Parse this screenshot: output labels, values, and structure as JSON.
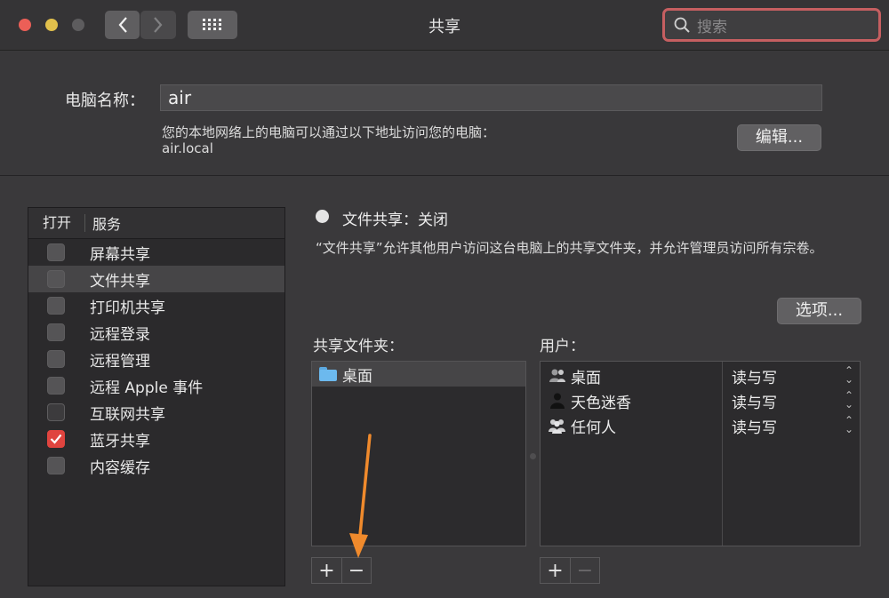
{
  "window": {
    "title": "共享"
  },
  "search": {
    "placeholder": "搜索"
  },
  "computer_name": {
    "label": "电脑名称：",
    "value": "air",
    "access_text": "您的本地网络上的电脑可以通过以下地址访问您的电脑：",
    "address": "air.local",
    "edit_button": "编辑..."
  },
  "services": {
    "header_on": "打开",
    "header_service": "服务",
    "items": [
      {
        "label": "屏幕共享",
        "checked": false,
        "selected": false,
        "dim": false
      },
      {
        "label": "文件共享",
        "checked": false,
        "selected": true,
        "dim": false
      },
      {
        "label": "打印机共享",
        "checked": false,
        "selected": false,
        "dim": false
      },
      {
        "label": "远程登录",
        "checked": false,
        "selected": false,
        "dim": false
      },
      {
        "label": "远程管理",
        "checked": false,
        "selected": false,
        "dim": false
      },
      {
        "label": "远程 Apple 事件",
        "checked": false,
        "selected": false,
        "dim": false
      },
      {
        "label": "互联网共享",
        "checked": false,
        "selected": false,
        "dim": true
      },
      {
        "label": "蓝牙共享",
        "checked": true,
        "selected": false,
        "dim": false
      },
      {
        "label": "内容缓存",
        "checked": false,
        "selected": false,
        "dim": false
      }
    ]
  },
  "file_sharing": {
    "status": "文件共享：关闭",
    "description": "“文件共享”允许其他用户访问这台电脑上的共享文件夹，并允许管理员访问所有宗卷。",
    "options_button": "选项...",
    "folders_label": "共享文件夹：",
    "users_label": "用户：",
    "folders": [
      "桌面"
    ],
    "users": [
      {
        "name": "桌面",
        "permission": "读与写",
        "icon": "group-icon"
      },
      {
        "name": "天色迷香",
        "permission": "读与写",
        "icon": "user-icon"
      },
      {
        "name": "任何人",
        "permission": "读与写",
        "icon": "everyone-icon"
      }
    ],
    "add_symbol": "+",
    "remove_symbol": "−"
  },
  "colors": {
    "accent_red": "#e0443f",
    "annotation_arrow": "#f08a2c",
    "search_focus_border": "#c65f61"
  }
}
